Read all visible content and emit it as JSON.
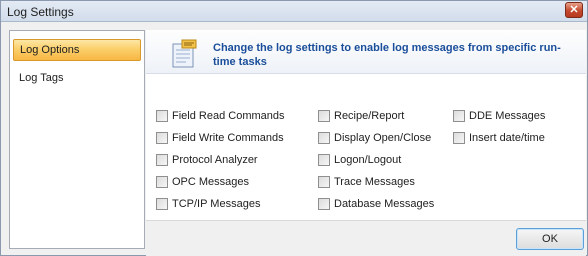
{
  "window": {
    "title": "Log Settings",
    "close_glyph": "✕"
  },
  "sidebar": {
    "items": [
      {
        "label": "Log Options",
        "selected": true
      },
      {
        "label": "Log Tags",
        "selected": false
      }
    ]
  },
  "banner": {
    "icon": "log-settings-icon",
    "text": "Change the log settings to enable log messages from specific run-time tasks"
  },
  "options": {
    "col1": [
      {
        "label": "Field Read Commands",
        "checked": false
      },
      {
        "label": "Field Write Commands",
        "checked": false
      },
      {
        "label": "Protocol Analyzer",
        "checked": false
      },
      {
        "label": "OPC Messages",
        "checked": false
      },
      {
        "label": "TCP/IP Messages",
        "checked": false
      }
    ],
    "col2": [
      {
        "label": "Recipe/Report",
        "checked": false
      },
      {
        "label": "Display Open/Close",
        "checked": false
      },
      {
        "label": "Logon/Logout",
        "checked": false
      },
      {
        "label": "Trace Messages",
        "checked": false
      },
      {
        "label": "Database Messages",
        "checked": false
      }
    ],
    "col3": [
      {
        "label": "DDE Messages",
        "checked": false
      },
      {
        "label": "Insert date/time",
        "checked": false
      }
    ]
  },
  "footer": {
    "ok_label": "OK"
  },
  "colors": {
    "accent_text": "#1a4e9a",
    "selection": "#f8b743",
    "close": "#c4482c"
  }
}
